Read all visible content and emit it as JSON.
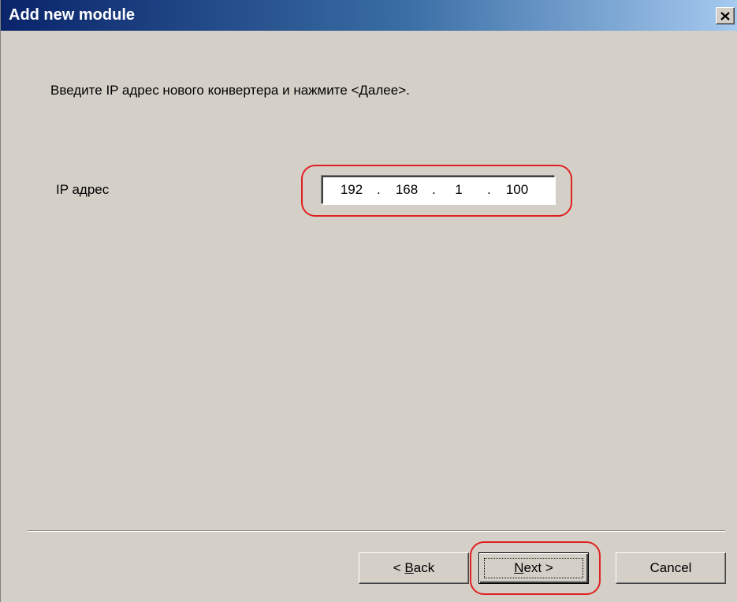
{
  "window": {
    "title": "Add new module",
    "close_symbol": "×"
  },
  "content": {
    "instruction": "Введите IP адрес нового конвертера и нажмите <Далее>.",
    "ip_label": "IP адрес",
    "ip_octets": [
      "192",
      "168",
      "1",
      "100"
    ],
    "ip_separator": "."
  },
  "buttons": {
    "back": {
      "prefix": "< ",
      "mnemonic": "B",
      "rest": "ack"
    },
    "next": {
      "mnemonic": "N",
      "rest": "ext >"
    },
    "cancel": {
      "label": "Cancel"
    }
  },
  "icons": {
    "close": "close-icon"
  },
  "colors": {
    "title_gradient_start": "#0a246a",
    "title_gradient_end": "#a6caf0",
    "dialog_face": "#d4d0c8",
    "annotation_red": "#e02020"
  }
}
